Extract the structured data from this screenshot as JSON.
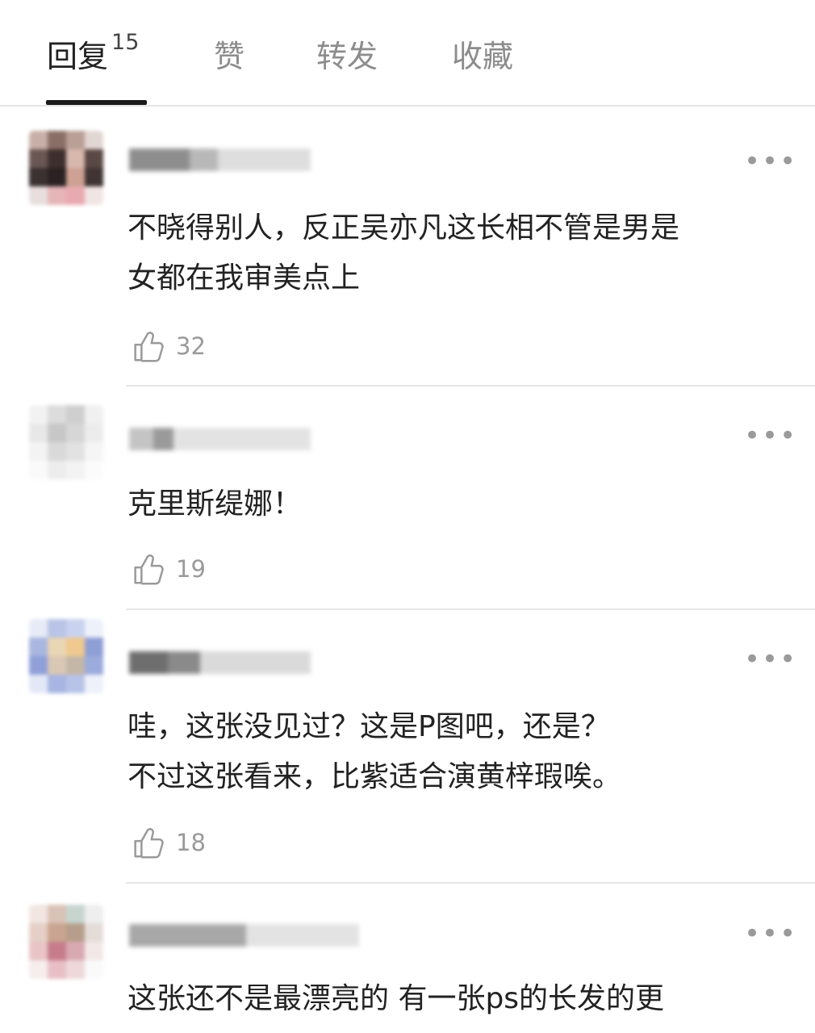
{
  "tabs": {
    "reply_label": "回复",
    "reply_count": "15",
    "like_label": "赞",
    "repost_label": "转发",
    "favorite_label": "收藏"
  },
  "more_label": "•••",
  "comments": [
    {
      "text": "不晓得别人，反正吴亦凡这长相不管是男是\n女都在我审美点上",
      "likes": "32"
    },
    {
      "text": "克里斯缇娜！",
      "likes": "19"
    },
    {
      "text": "哇，这张没见过？这是P图吧，还是？\n不过这张看来，比紫适合演黄梓瑕唉。",
      "likes": "18"
    },
    {
      "text": "这张还不是最漂亮的 有一张ps的长发的更",
      "likes": ""
    }
  ]
}
